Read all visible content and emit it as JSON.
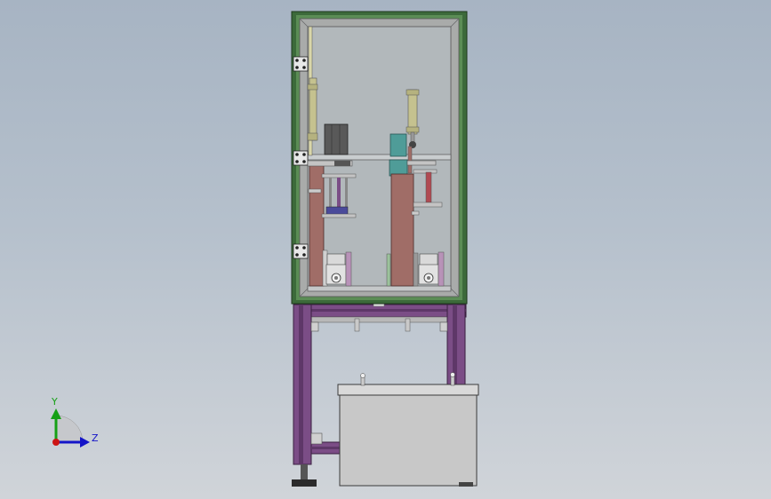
{
  "viewport": {
    "background_top": "#a7b4c3",
    "background_bottom": "#d0d4d9"
  },
  "colors": {
    "frame_green": "#3c6a3a",
    "frame_purple": "#7b4d86",
    "panel_gray": "#a9abaa",
    "glass": "#b2b8bb",
    "column_brown": "#a06d67",
    "cylinder_olive": "#c5c28f",
    "teal_block": "#4f9c98",
    "box_gray": "#c8c8c8",
    "axis_y": "#16a016",
    "axis_z": "#1414c8",
    "axis_x": "#cc1414"
  },
  "triad": {
    "y_label": "Y",
    "z_label": "Z",
    "icon": "coordinate-triad-icon"
  }
}
